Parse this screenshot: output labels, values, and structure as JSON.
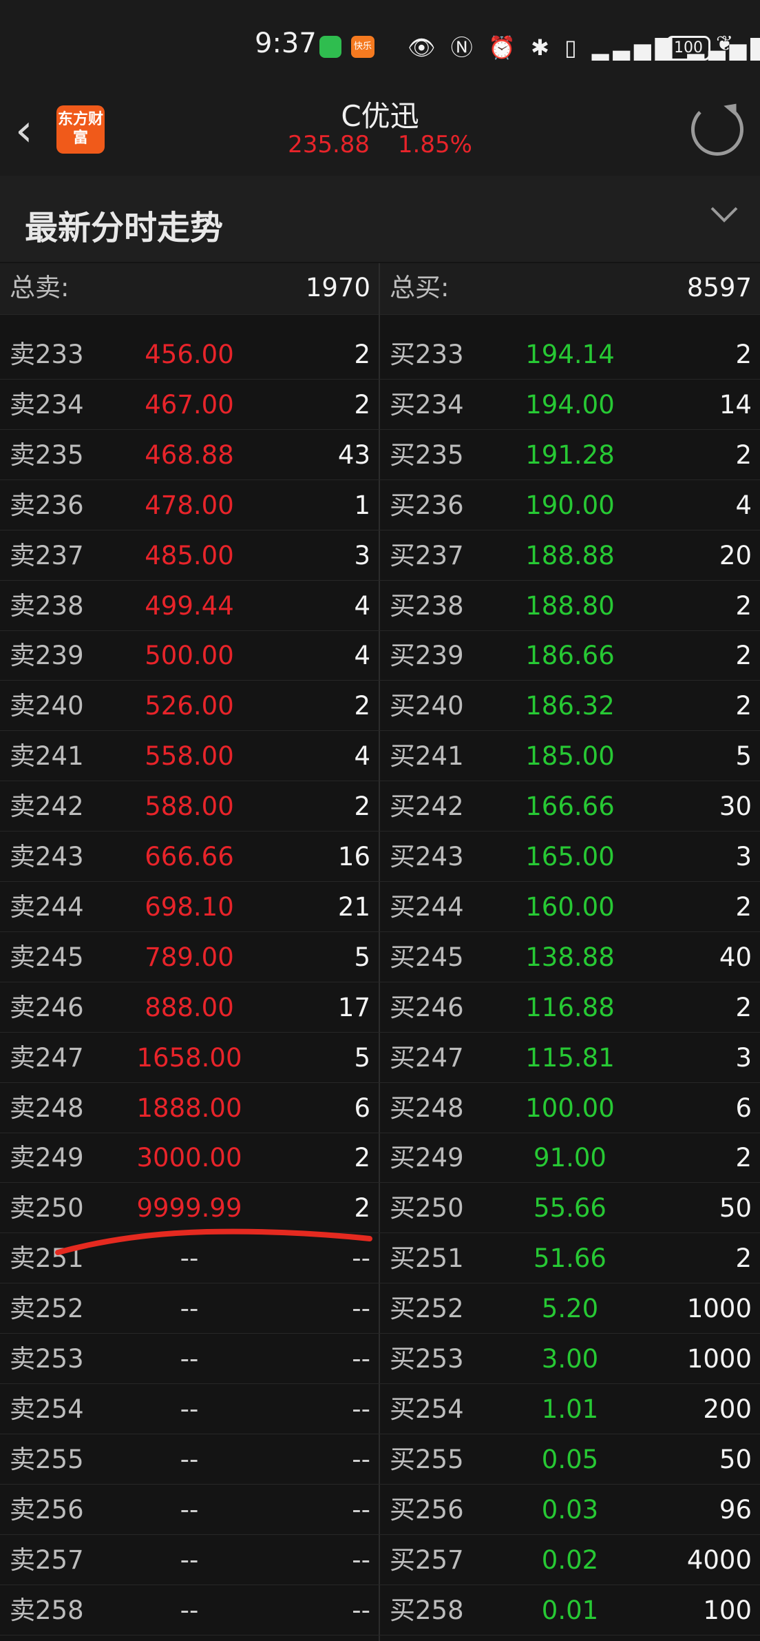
{
  "status_bar": {
    "time": "9:37",
    "app_badge": "快乐",
    "battery": "100"
  },
  "header": {
    "logo_text": "东方财富",
    "stock_name": "C优迅",
    "price": "235.88",
    "change_pct": "1.85%"
  },
  "section": {
    "title": "最新分时走势"
  },
  "totals": {
    "sell_label": "总卖:",
    "sell_value": "1970",
    "buy_label": "总买:",
    "buy_value": "8597"
  },
  "book": [
    {
      "sell_label": "卖233",
      "sell_price": "456.00",
      "sell_vol": "2",
      "buy_label": "买233",
      "buy_price": "194.14",
      "buy_vol": "2"
    },
    {
      "sell_label": "卖234",
      "sell_price": "467.00",
      "sell_vol": "2",
      "buy_label": "买234",
      "buy_price": "194.00",
      "buy_vol": "14"
    },
    {
      "sell_label": "卖235",
      "sell_price": "468.88",
      "sell_vol": "43",
      "buy_label": "买235",
      "buy_price": "191.28",
      "buy_vol": "2"
    },
    {
      "sell_label": "卖236",
      "sell_price": "478.00",
      "sell_vol": "1",
      "buy_label": "买236",
      "buy_price": "190.00",
      "buy_vol": "4"
    },
    {
      "sell_label": "卖237",
      "sell_price": "485.00",
      "sell_vol": "3",
      "buy_label": "买237",
      "buy_price": "188.88",
      "buy_vol": "20"
    },
    {
      "sell_label": "卖238",
      "sell_price": "499.44",
      "sell_vol": "4",
      "buy_label": "买238",
      "buy_price": "188.80",
      "buy_vol": "2"
    },
    {
      "sell_label": "卖239",
      "sell_price": "500.00",
      "sell_vol": "4",
      "buy_label": "买239",
      "buy_price": "186.66",
      "buy_vol": "2"
    },
    {
      "sell_label": "卖240",
      "sell_price": "526.00",
      "sell_vol": "2",
      "buy_label": "买240",
      "buy_price": "186.32",
      "buy_vol": "2"
    },
    {
      "sell_label": "卖241",
      "sell_price": "558.00",
      "sell_vol": "4",
      "buy_label": "买241",
      "buy_price": "185.00",
      "buy_vol": "5"
    },
    {
      "sell_label": "卖242",
      "sell_price": "588.00",
      "sell_vol": "2",
      "buy_label": "买242",
      "buy_price": "166.66",
      "buy_vol": "30"
    },
    {
      "sell_label": "卖243",
      "sell_price": "666.66",
      "sell_vol": "16",
      "buy_label": "买243",
      "buy_price": "165.00",
      "buy_vol": "3"
    },
    {
      "sell_label": "卖244",
      "sell_price": "698.10",
      "sell_vol": "21",
      "buy_label": "买244",
      "buy_price": "160.00",
      "buy_vol": "2"
    },
    {
      "sell_label": "卖245",
      "sell_price": "789.00",
      "sell_vol": "5",
      "buy_label": "买245",
      "buy_price": "138.88",
      "buy_vol": "40"
    },
    {
      "sell_label": "卖246",
      "sell_price": "888.00",
      "sell_vol": "17",
      "buy_label": "买246",
      "buy_price": "116.88",
      "buy_vol": "2"
    },
    {
      "sell_label": "卖247",
      "sell_price": "1658.00",
      "sell_vol": "5",
      "buy_label": "买247",
      "buy_price": "115.81",
      "buy_vol": "3"
    },
    {
      "sell_label": "卖248",
      "sell_price": "1888.00",
      "sell_vol": "6",
      "buy_label": "买248",
      "buy_price": "100.00",
      "buy_vol": "6"
    },
    {
      "sell_label": "卖249",
      "sell_price": "3000.00",
      "sell_vol": "2",
      "buy_label": "买249",
      "buy_price": "91.00",
      "buy_vol": "2"
    },
    {
      "sell_label": "卖250",
      "sell_price": "9999.99",
      "sell_vol": "2",
      "buy_label": "买250",
      "buy_price": "55.66",
      "buy_vol": "50"
    },
    {
      "sell_label": "卖251",
      "sell_price": "--",
      "sell_vol": "--",
      "buy_label": "买251",
      "buy_price": "51.66",
      "buy_vol": "2"
    },
    {
      "sell_label": "卖252",
      "sell_price": "--",
      "sell_vol": "--",
      "buy_label": "买252",
      "buy_price": "5.20",
      "buy_vol": "1000"
    },
    {
      "sell_label": "卖253",
      "sell_price": "--",
      "sell_vol": "--",
      "buy_label": "买253",
      "buy_price": "3.00",
      "buy_vol": "1000"
    },
    {
      "sell_label": "卖254",
      "sell_price": "--",
      "sell_vol": "--",
      "buy_label": "买254",
      "buy_price": "1.01",
      "buy_vol": "200"
    },
    {
      "sell_label": "卖255",
      "sell_price": "--",
      "sell_vol": "--",
      "buy_label": "买255",
      "buy_price": "0.05",
      "buy_vol": "50"
    },
    {
      "sell_label": "卖256",
      "sell_price": "--",
      "sell_vol": "--",
      "buy_label": "买256",
      "buy_price": "0.03",
      "buy_vol": "96"
    },
    {
      "sell_label": "卖257",
      "sell_price": "--",
      "sell_vol": "--",
      "buy_label": "买257",
      "buy_price": "0.02",
      "buy_vol": "4000"
    },
    {
      "sell_label": "卖258",
      "sell_price": "--",
      "sell_vol": "--",
      "buy_label": "买258",
      "buy_price": "0.01",
      "buy_vol": "100"
    }
  ],
  "colors": {
    "sell_price": "#e8242a",
    "buy_price": "#27c934",
    "annotation": "#e52a20"
  }
}
